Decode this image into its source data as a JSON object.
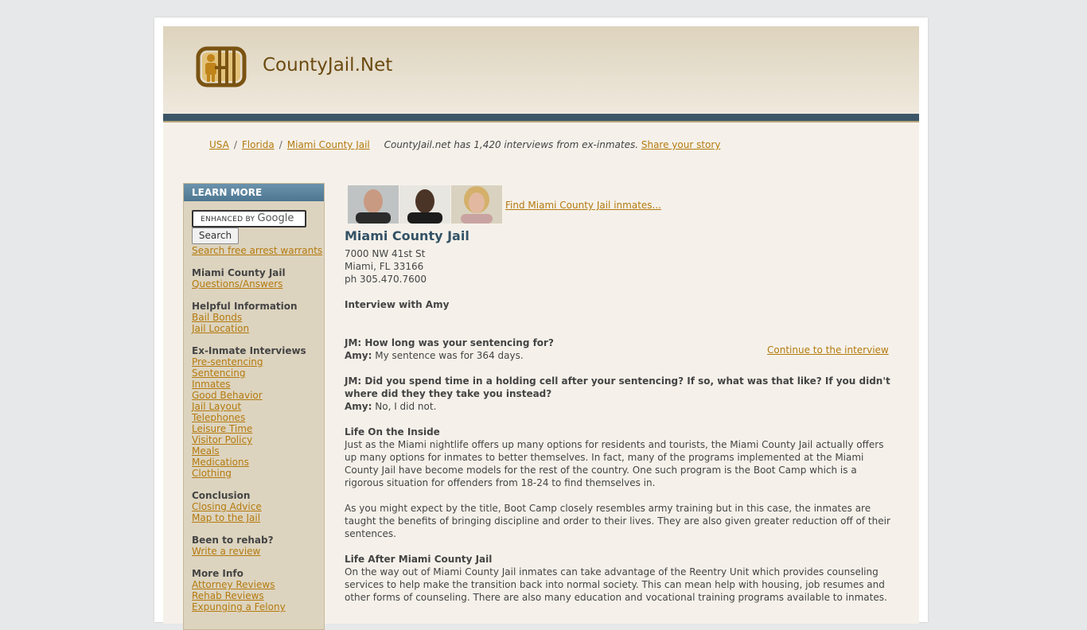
{
  "site": {
    "title": "CountyJail.Net"
  },
  "breadcrumb": {
    "items": [
      "USA",
      "Florida",
      "Miami County Jail"
    ],
    "note": "CountyJail.net has 1,420 interviews from ex-inmates.",
    "share_link": "Share your story"
  },
  "sidebar": {
    "heading": "LEARN MORE",
    "search_placeholder": "ENHANCED BY",
    "search_brand": "Google",
    "search_button": "Search",
    "warrants_link": "Search free arrest warrants",
    "sections": [
      {
        "heading": "Miami County Jail",
        "links": [
          "Questions/Answers"
        ]
      },
      {
        "heading": "Helpful Information",
        "links": [
          "Bail Bonds",
          "Jail Location"
        ]
      },
      {
        "heading": "Ex-Inmate Interviews",
        "links": [
          "Pre-sentencing",
          "Sentencing",
          "Inmates",
          "Good Behavior",
          "Jail Layout",
          "Telephones",
          "Leisure Time",
          "Visitor Policy",
          "Meals",
          "Medications",
          "Clothing"
        ]
      },
      {
        "heading": "Conclusion",
        "links": [
          "Closing Advice",
          "Map to the Jail"
        ]
      },
      {
        "heading": "Been to rehab?",
        "links": [
          "Write a review"
        ]
      },
      {
        "heading": "More Info",
        "links": [
          "Attorney Reviews",
          "Rehab Reviews",
          "Expunging a Felony"
        ]
      }
    ]
  },
  "main": {
    "find_link": "Find Miami County Jail inmates...",
    "jail_name": "Miami County Jail",
    "address": [
      "7000 NW 41st St",
      "Miami, FL 33166",
      "ph 305.470.7600"
    ],
    "interview_title": "Interview with Amy",
    "continue_link": "Continue to the interview",
    "qa": [
      {
        "q": "JM: How long was your sentencing for?",
        "who": "Amy:",
        "a": "My sentence was for 364 days."
      },
      {
        "q": "JM: Did you spend time in a holding cell after your sentencing? If so, what was that like? If you didn't where did they they take you instead?",
        "who": "Amy:",
        "a": "No, I did not."
      }
    ],
    "sections": [
      {
        "title": "Life On the Inside",
        "text": "Just as the Miami nightlife offers up many options for residents and tourists, the Miami County Jail actually offers up many options for inmates to better themselves. In fact, many of the programs implemented at the Miami County Jail have become models for the rest of the country. One such program is the Boot Camp which is a rigorous situation for offenders from 18-24 to find themselves in."
      },
      {
        "title": "",
        "text": "As you might expect by the title, Boot Camp closely resembles army training but in this case, the inmates are taught the benefits of bringing discipline and order to their lives. They are also given greater reduction off of their sentences."
      },
      {
        "title": "Life After Miami County Jail",
        "text": "On the way out of Miami County Jail inmates can take advantage of the Reentry Unit which provides counseling services to help make the transition back into normal society. This can mean help with housing, job resumes and other forms of counseling. There are also many education and vocational training programs available to inmates."
      }
    ]
  }
}
